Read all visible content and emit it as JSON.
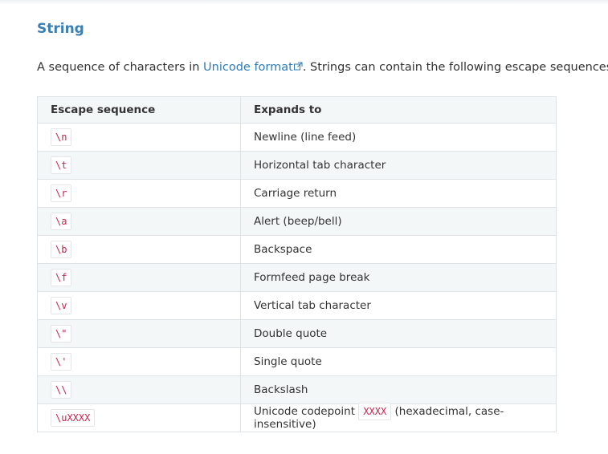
{
  "section": {
    "title": "String",
    "intro_before": "A sequence of characters in ",
    "intro_link": "Unicode format",
    "intro_after": ". Strings can contain the following escape sequences:"
  },
  "table": {
    "headers": [
      "Escape sequence",
      "Expands to"
    ],
    "rows": [
      {
        "seq": "\\n",
        "desc": "Newline (line feed)"
      },
      {
        "seq": "\\t",
        "desc": "Horizontal tab character"
      },
      {
        "seq": "\\r",
        "desc": "Carriage return"
      },
      {
        "seq": "\\a",
        "desc": "Alert (beep/bell)"
      },
      {
        "seq": "\\b",
        "desc": "Backspace"
      },
      {
        "seq": "\\f",
        "desc": "Formfeed page break"
      },
      {
        "seq": "\\v",
        "desc": "Vertical tab character"
      },
      {
        "seq": "\\\"",
        "desc": "Double quote"
      },
      {
        "seq": "\\'",
        "desc": "Single quote"
      },
      {
        "seq": "\\\\",
        "desc": "Backslash"
      },
      {
        "seq": "\\uXXXX",
        "desc_before": "Unicode codepoint ",
        "desc_code": "XXXX",
        "desc_after": " (hexadecimal, case-insensitive)"
      }
    ]
  },
  "colors": {
    "heading": "#3c7fb3",
    "link": "#2e7bb8",
    "code": "#c7254e",
    "table_stripe": "#f4f7f8",
    "table_border": "#dde3e7"
  },
  "icons": {
    "external_link": "external-link-icon"
  }
}
